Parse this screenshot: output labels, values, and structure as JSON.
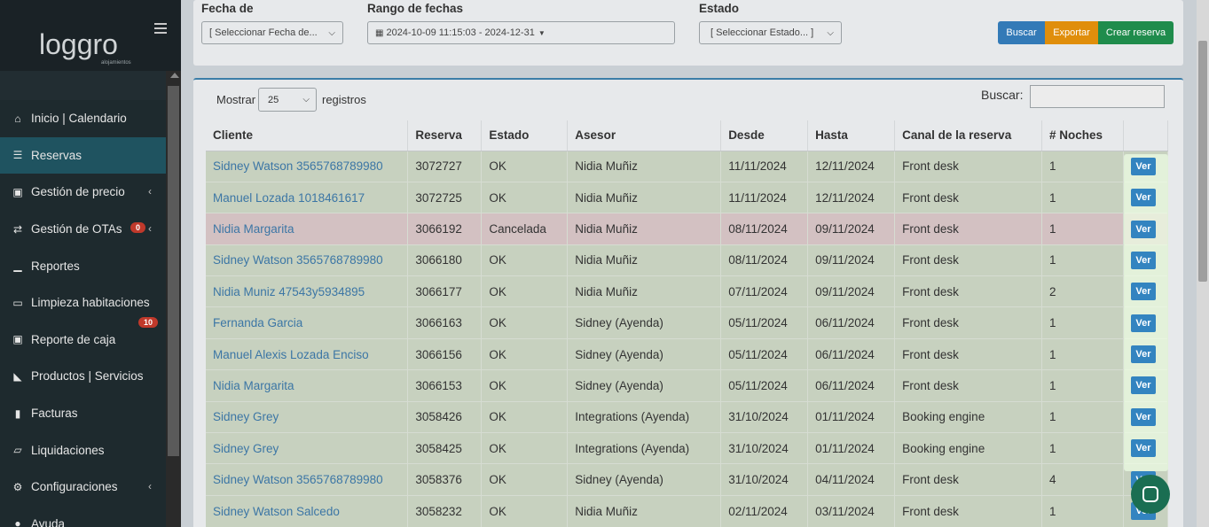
{
  "sidebar": {
    "logo_text": "loggro",
    "logo_sub": "alojamientos",
    "items": [
      {
        "label": "Inicio | Calendario",
        "icon": "home-icon",
        "active": false
      },
      {
        "label": "Reservas",
        "icon": "list-icon",
        "active": true
      },
      {
        "label": "Gestión de precio",
        "icon": "money-icon",
        "active": false,
        "chevron": true
      },
      {
        "label": "Gestión de OTAs",
        "icon": "exchange-icon",
        "active": false,
        "chevron": true,
        "badge": "0"
      },
      {
        "label": "Reportes",
        "icon": "bar-chart-icon",
        "active": false
      },
      {
        "label": "Limpieza habitaciones",
        "icon": "bath-icon",
        "active": false
      },
      {
        "label": "Reporte de caja",
        "icon": "cash-icon",
        "active": false,
        "badge": "10"
      },
      {
        "label": "Productos | Servicios",
        "icon": "cart-icon",
        "active": false
      },
      {
        "label": "Facturas",
        "icon": "book-icon",
        "active": false
      },
      {
        "label": "Liquidaciones",
        "icon": "folder-open-icon",
        "active": false
      },
      {
        "label": "Configuraciones",
        "icon": "gear-icon",
        "active": false,
        "chevron": true
      },
      {
        "label": "Ayuda",
        "icon": "help-icon",
        "active": false
      }
    ]
  },
  "filters": {
    "fecha_label": "Fecha de",
    "fecha_value": "[ Seleccionar Fecha de...",
    "rango_label": "Rango de fechas",
    "rango_value": "2024-10-09 11:15:03 - 2024-12-31",
    "estado_label": "Estado",
    "estado_value": "[ Seleccionar Estado... ]",
    "buscar_btn": "Buscar",
    "exportar_btn": "Exportar",
    "crear_btn": "Crear reserva"
  },
  "table_controls": {
    "mostrar_label": "Mostrar",
    "page_size": "25",
    "registros_label": "registros",
    "buscar_label": "Buscar:"
  },
  "table": {
    "headers": [
      "Cliente",
      "Reserva",
      "Estado",
      "Asesor",
      "Desde",
      "Hasta",
      "Canal de la reserva",
      "# Noches",
      ""
    ],
    "action_label": "Ver",
    "rows": [
      {
        "cliente": "Sidney Watson 3565768789980",
        "reserva": "3072727",
        "estado": "OK",
        "asesor": "Nidia Muñiz",
        "desde": "11/11/2024",
        "hasta": "12/11/2024",
        "canal": "Front desk",
        "noches": "1",
        "status": "ok"
      },
      {
        "cliente": "Manuel Lozada 1018461617",
        "reserva": "3072725",
        "estado": "OK",
        "asesor": "Nidia Muñiz",
        "desde": "11/11/2024",
        "hasta": "12/11/2024",
        "canal": "Front desk",
        "noches": "1",
        "status": "ok"
      },
      {
        "cliente": "Nidia Margarita",
        "reserva": "3066192",
        "estado": "Cancelada",
        "asesor": "Nidia Muñiz",
        "desde": "08/11/2024",
        "hasta": "09/11/2024",
        "canal": "Front desk",
        "noches": "1",
        "status": "cancel"
      },
      {
        "cliente": "Sidney Watson 3565768789980",
        "reserva": "3066180",
        "estado": "OK",
        "asesor": "Nidia Muñiz",
        "desde": "08/11/2024",
        "hasta": "09/11/2024",
        "canal": "Front desk",
        "noches": "1",
        "status": "ok"
      },
      {
        "cliente": "Nidia Muniz 47543y5934895",
        "reserva": "3066177",
        "estado": "OK",
        "asesor": "Nidia Muñiz",
        "desde": "07/11/2024",
        "hasta": "09/11/2024",
        "canal": "Front desk",
        "noches": "2",
        "status": "ok"
      },
      {
        "cliente": "Fernanda Garcia",
        "reserva": "3066163",
        "estado": "OK",
        "asesor": "Sidney (Ayenda)",
        "desde": "05/11/2024",
        "hasta": "06/11/2024",
        "canal": "Front desk",
        "noches": "1",
        "status": "ok"
      },
      {
        "cliente": "Manuel Alexis Lozada Enciso",
        "reserva": "3066156",
        "estado": "OK",
        "asesor": "Sidney (Ayenda)",
        "desde": "05/11/2024",
        "hasta": "06/11/2024",
        "canal": "Front desk",
        "noches": "1",
        "status": "ok"
      },
      {
        "cliente": "Nidia Margarita",
        "reserva": "3066153",
        "estado": "OK",
        "asesor": "Sidney (Ayenda)",
        "desde": "05/11/2024",
        "hasta": "06/11/2024",
        "canal": "Front desk",
        "noches": "1",
        "status": "ok"
      },
      {
        "cliente": "Sidney Grey",
        "reserva": "3058426",
        "estado": "OK",
        "asesor": "Integrations (Ayenda)",
        "desde": "31/10/2024",
        "hasta": "01/11/2024",
        "canal": "Booking engine",
        "noches": "1",
        "status": "ok"
      },
      {
        "cliente": "Sidney Grey",
        "reserva": "3058425",
        "estado": "OK",
        "asesor": "Integrations (Ayenda)",
        "desde": "31/10/2024",
        "hasta": "01/11/2024",
        "canal": "Booking engine",
        "noches": "1",
        "status": "ok"
      },
      {
        "cliente": "Sidney Watson 3565768789980",
        "reserva": "3058376",
        "estado": "OK",
        "asesor": "Sidney (Ayenda)",
        "desde": "31/10/2024",
        "hasta": "04/11/2024",
        "canal": "Front desk",
        "noches": "4",
        "status": "ok"
      },
      {
        "cliente": "Sidney Watson Salcedo",
        "reserva": "3058232",
        "estado": "OK",
        "asesor": "Nidia Muñiz",
        "desde": "02/11/2024",
        "hasta": "03/11/2024",
        "canal": "Front desk",
        "noches": "1",
        "status": "ok"
      }
    ]
  },
  "colors": {
    "sidebar_bg": "#222d32",
    "active_item": "#1f5360",
    "buscar": "#337ab7",
    "exportar": "#e08e0b",
    "crear": "#1f8c4c",
    "link": "#3c76a5"
  }
}
